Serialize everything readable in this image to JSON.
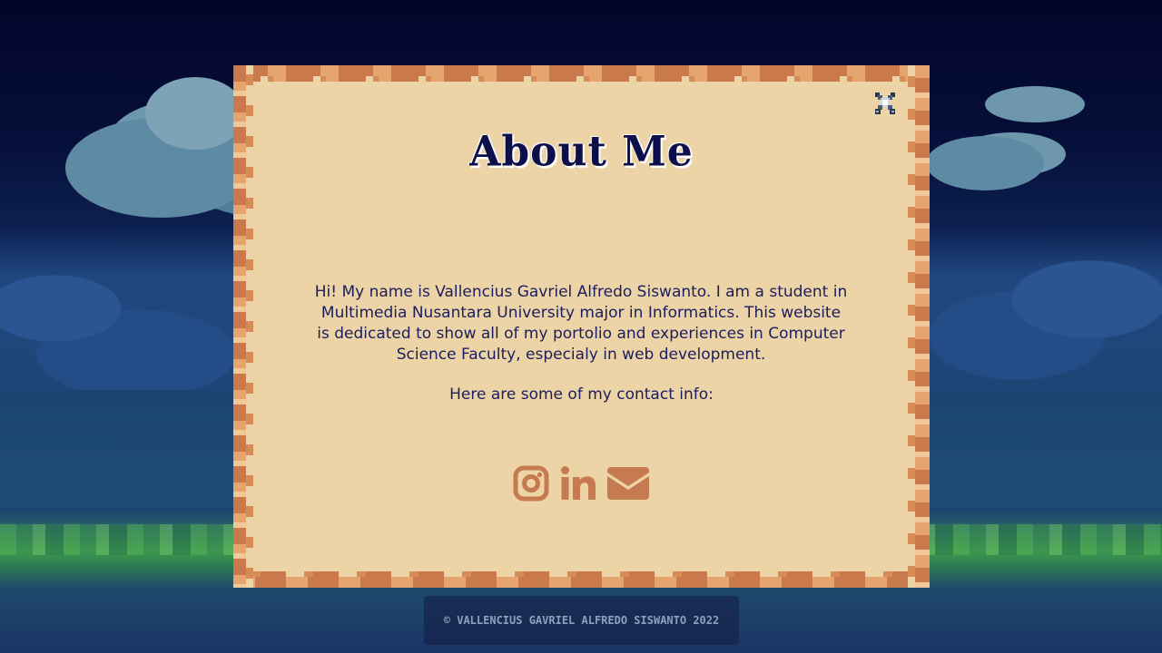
{
  "modal": {
    "title": "About Me",
    "bio": "Hi! My name is Vallencius Gavriel Alfredo Siswanto. I am a student in Multimedia Nusantara University major in Informatics. This website is dedicated to show all of my portolio and experiences in Computer Science Faculty, especialy in web development.",
    "contact_label": "Here are some of my contact info:",
    "close_icon": "close-icon",
    "social": [
      {
        "icon": "instagram-icon"
      },
      {
        "icon": "linkedin-icon"
      },
      {
        "icon": "email-icon"
      }
    ]
  },
  "footer": {
    "copyright": "© VALLENCIUS GAVRIEL ALFREDO SISWANTO 2022"
  },
  "colors": {
    "panel": "#ecd4a6",
    "panel_border": "#c9794c",
    "icon": "#c57a50",
    "text": "#1b1d5e"
  }
}
